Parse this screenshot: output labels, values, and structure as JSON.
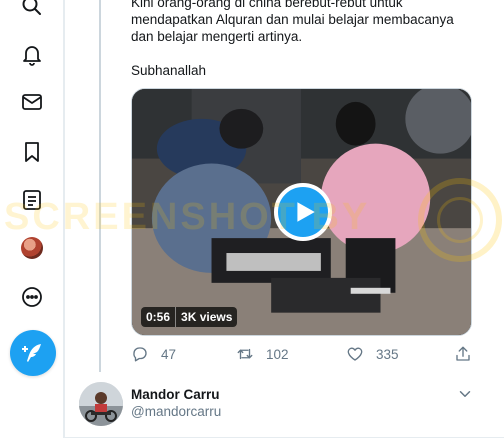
{
  "tweet": {
    "text_lines": [
      "Kini orang-orang di china berebut-rebut untuk",
      "mendapatkan Alquran dan mulai belajar membacanya",
      "dan belajar mengerti artinya."
    ],
    "text_closing": "Subhanallah",
    "video": {
      "duration": "0:56",
      "views": "3K views"
    },
    "actions": {
      "replies": "47",
      "retweets": "102",
      "likes": "335"
    }
  },
  "next_tweet": {
    "display_name": "Mandor Carru",
    "handle": "@mandorcarru"
  },
  "watermark": {
    "text": "SCREENSHOT BY"
  },
  "nav": {
    "icons": [
      "search-icon",
      "bell-icon",
      "mail-icon",
      "bookmark-icon",
      "list-icon",
      "profile-avatar",
      "more-icon"
    ],
    "compose_icon": "feather-plus-icon"
  },
  "colors": {
    "accent": "#1da1f2",
    "secondary_text": "#657786",
    "primary_text": "#14171a",
    "border": "#e6ecf0"
  }
}
